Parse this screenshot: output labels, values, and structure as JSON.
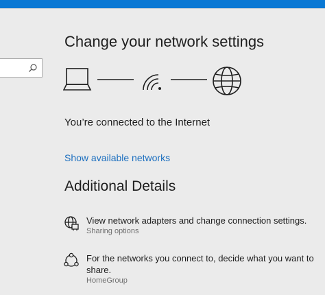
{
  "window": {
    "accent": "#0a78d4"
  },
  "search": {
    "placeholder": "",
    "icon": "search-icon"
  },
  "page": {
    "title": "Change your network settings",
    "connection_status": "You’re connected to the Internet",
    "show_networks_link": "Show available networks"
  },
  "diagram": {
    "device_icon": "laptop-icon",
    "network_icon": "wifi-icon",
    "internet_icon": "globe-icon"
  },
  "additional": {
    "title": "Additional Details",
    "items": [
      {
        "icon": "network-adapter-icon",
        "text": "View network adapters and change connection settings.",
        "sub": "Sharing options"
      },
      {
        "icon": "homegroup-icon",
        "text": "For the networks you connect to, decide what you want to share.",
        "sub": "HomeGroup"
      }
    ]
  },
  "colors": {
    "link": "#1c6fbf",
    "background": "#ebebeb",
    "subtext": "#6f6f6f"
  }
}
